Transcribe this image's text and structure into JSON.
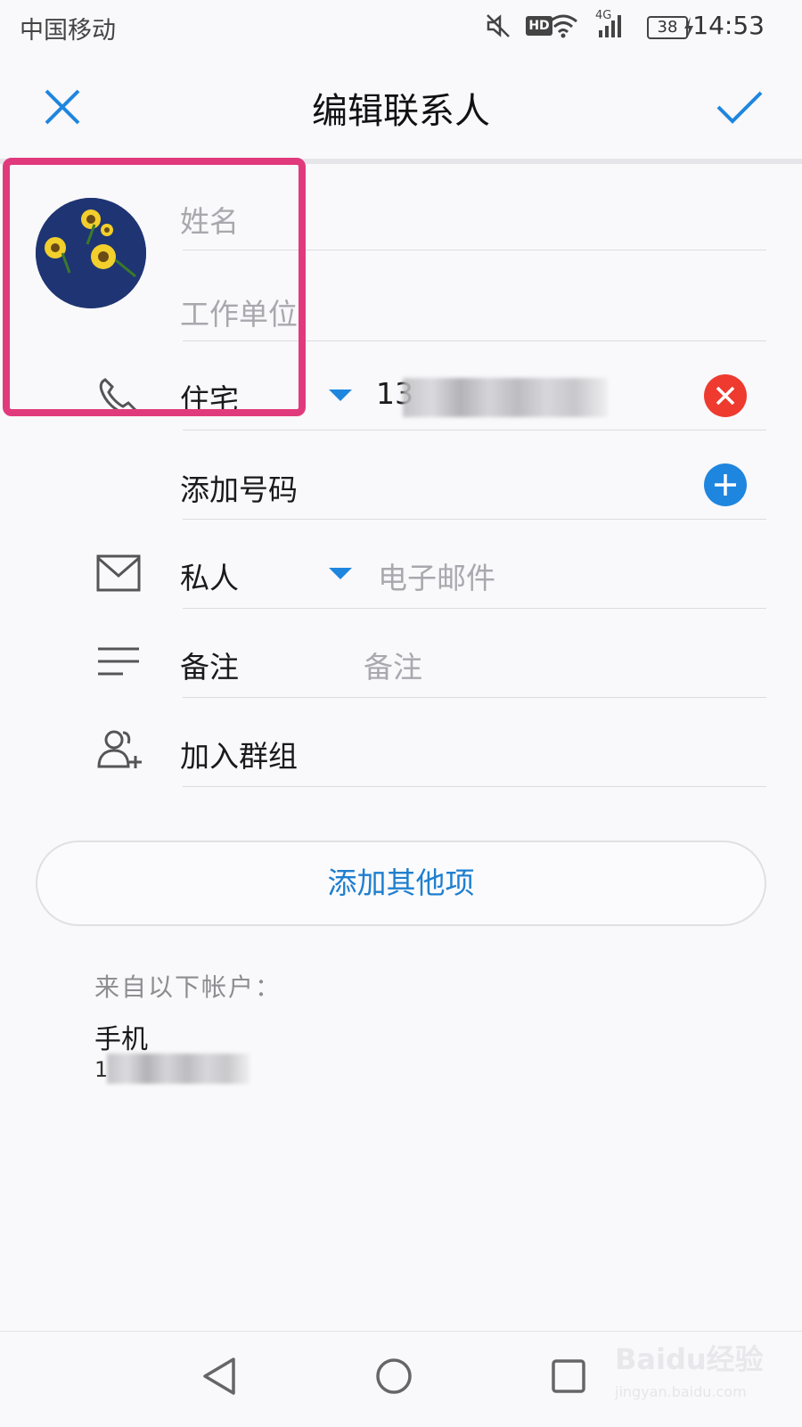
{
  "status_bar": {
    "carrier": "中国移动",
    "hd": "HD",
    "network": "4G",
    "battery": "38",
    "time": "14:53"
  },
  "header": {
    "title": "编辑联系人",
    "close_icon": "close-icon",
    "confirm_icon": "checkmark-icon"
  },
  "form": {
    "name_placeholder": "姓名",
    "company_placeholder": "工作单位",
    "phone": {
      "type": "住宅",
      "value_prefix": "13"
    },
    "add_number": "添加号码",
    "email": {
      "type": "私人",
      "placeholder": "电子邮件"
    },
    "notes": {
      "label": "备注",
      "placeholder": "备注"
    },
    "groups": "加入群组"
  },
  "add_other": "添加其他项",
  "account": {
    "header": "来自以下帐户：",
    "name": "手机",
    "number_prefix": "1"
  },
  "watermark": {
    "brand": "Baidu经验",
    "url": "jingyan.baidu.com"
  },
  "colors": {
    "accent": "#1f86df",
    "highlight": "#e03a7c",
    "delete": "#ee3a2f",
    "add": "#1f86df"
  }
}
